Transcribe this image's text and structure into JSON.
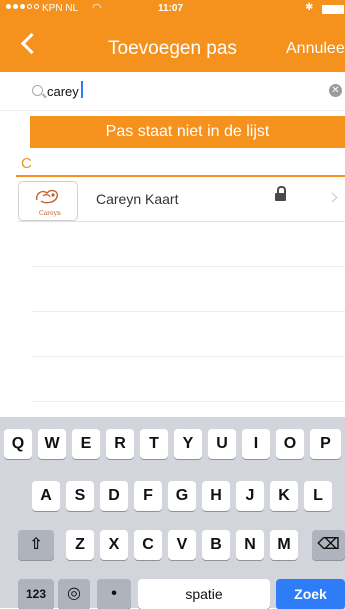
{
  "status_bar": {
    "carrier": "KPN NL",
    "time": "11:07"
  },
  "nav": {
    "title": "Toevoegen pas",
    "cancel_label": "Annuleer"
  },
  "search": {
    "value": "carey"
  },
  "not_in_list_label": "Pas staat niet in de lijst",
  "section": {
    "letter": "C"
  },
  "cards": [
    {
      "name": "Careyn Kaart",
      "logo_text": "Careyn",
      "locked": true
    }
  ],
  "keyboard": {
    "row1": [
      "Q",
      "W",
      "E",
      "R",
      "T",
      "Y",
      "U",
      "I",
      "O",
      "P"
    ],
    "row2": [
      "A",
      "S",
      "D",
      "F",
      "G",
      "H",
      "J",
      "K",
      "L"
    ],
    "row3": [
      "Z",
      "X",
      "C",
      "V",
      "B",
      "N",
      "M"
    ],
    "numbers_label": "123",
    "space_label": "spatie",
    "return_label": "Zoek"
  },
  "colors": {
    "accent": "#f5921e",
    "keyboard_bg": "#d2d5db",
    "return_key": "#2e7cf6"
  }
}
